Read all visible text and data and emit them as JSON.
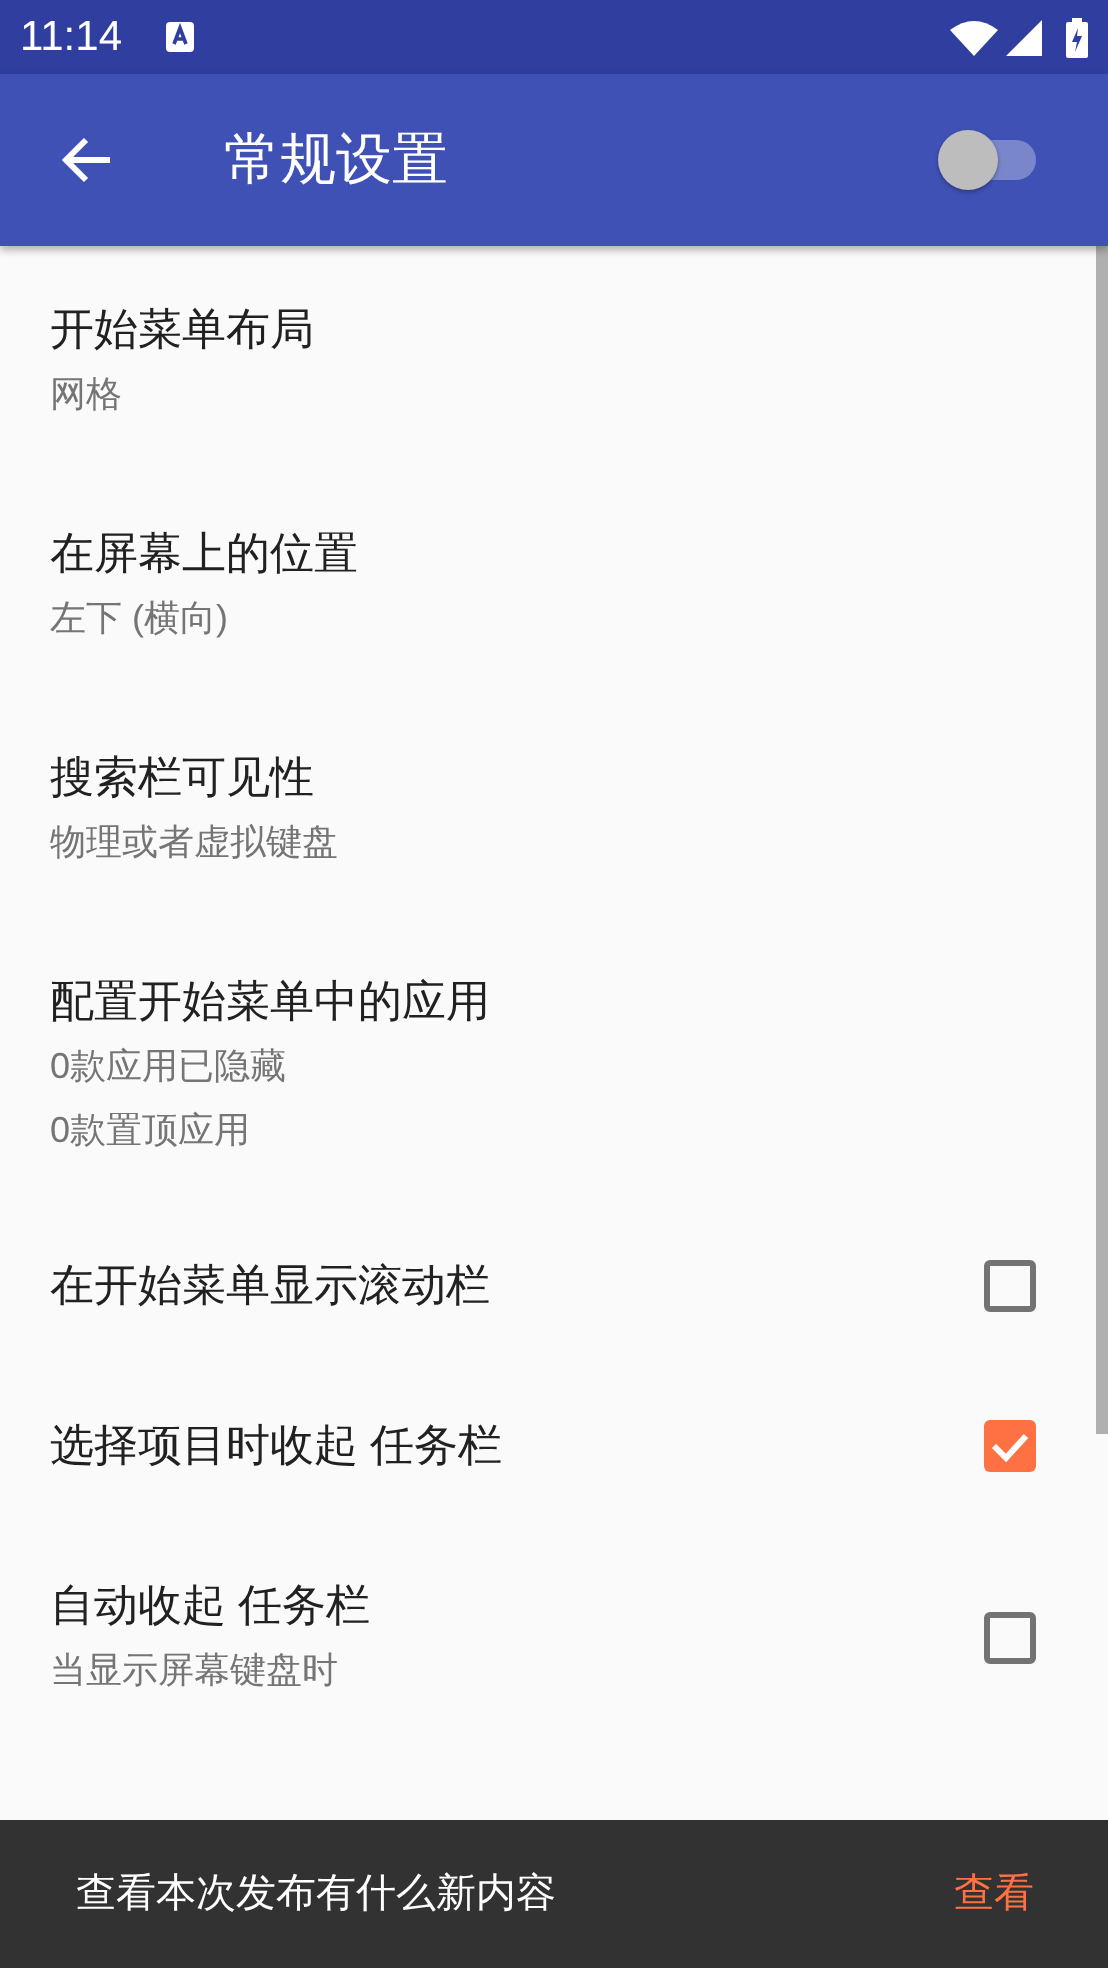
{
  "status_bar": {
    "time": "11:14"
  },
  "app_bar": {
    "title": "常规设置",
    "switch_on": false
  },
  "settings": [
    {
      "kind": "text",
      "title": "开始菜单布局",
      "subtitles": [
        "网格"
      ]
    },
    {
      "kind": "text",
      "title": "在屏幕上的位置",
      "subtitles": [
        "左下 (横向)"
      ]
    },
    {
      "kind": "text",
      "title": "搜索栏可见性",
      "subtitles": [
        "物理或者虚拟键盘"
      ]
    },
    {
      "kind": "text",
      "title": "配置开始菜单中的应用",
      "subtitles": [
        "0款应用已隐藏",
        "0款置顶应用"
      ]
    },
    {
      "kind": "checkbox",
      "title": "在开始菜单显示滚动栏",
      "checked": false
    },
    {
      "kind": "checkbox",
      "title": "选择项目时收起 任务栏",
      "checked": true
    },
    {
      "kind": "checkbox",
      "title": "自动收起 任务栏",
      "subtitles": [
        "当显示屏幕键盘时"
      ],
      "checked": false
    }
  ],
  "snackbar": {
    "message": "查看本次发布有什么新内容",
    "action": "查看"
  }
}
